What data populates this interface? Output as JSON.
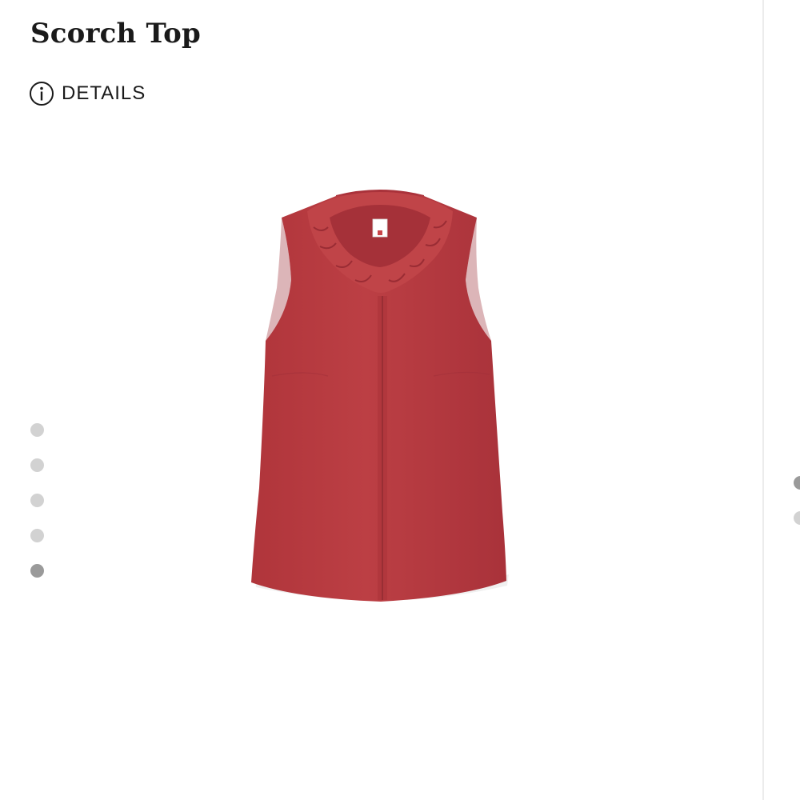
{
  "product": {
    "title": "Scorch Top",
    "details_label": "DETAILS",
    "details_icon": "info-circle-icon",
    "image": {
      "description_name": "red-sleeveless-ruffle-collar-top",
      "main_color": "#b83a3f",
      "label_tag_text": "cabi"
    }
  },
  "carousel": {
    "total_images": 5,
    "active_index": 5
  },
  "colors": {
    "text": "#1a1a1a",
    "dot_inactive": "#d2d2d2",
    "dot_active": "#9a9a9a",
    "divider": "#ececec"
  }
}
